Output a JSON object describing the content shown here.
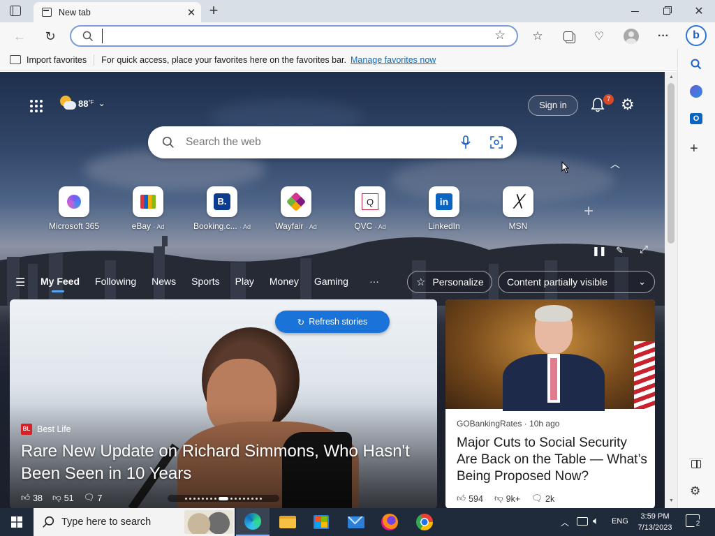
{
  "browser": {
    "tab_title": "New tab",
    "favorites_bar": {
      "import_label": "Import favorites",
      "message": "For quick access, place your favorites here on the favorites bar.",
      "manage_link": "Manage favorites now"
    },
    "address": {
      "value": "",
      "placeholder": ""
    }
  },
  "newtab": {
    "weather": {
      "temp": "88",
      "unit": "°F"
    },
    "sign_in_label": "Sign in",
    "notification_count": "7",
    "search_placeholder": "Search the web",
    "shortcuts": [
      {
        "label": "Microsoft 365",
        "ad": ""
      },
      {
        "label": "eBay",
        "ad": "· Ad"
      },
      {
        "label": "Booking.c...",
        "ad": "· Ad"
      },
      {
        "label": "Wayfair",
        "ad": "· Ad"
      },
      {
        "label": "QVC",
        "ad": "· Ad"
      },
      {
        "label": "LinkedIn",
        "ad": ""
      },
      {
        "label": "MSN",
        "ad": ""
      }
    ],
    "feed_nav": [
      "My Feed",
      "Following",
      "News",
      "Sports",
      "Play",
      "Money",
      "Gaming"
    ],
    "more_label": "···",
    "personalize_label": "Personalize",
    "content_visibility": "Content partially visible",
    "refresh_label": "Refresh stories",
    "main_story": {
      "source": "Best Life",
      "source_badge": "BL",
      "headline": "Rare New Update on Richard Simmons, Who Hasn't Been Seen in 10 Years",
      "likes": "38",
      "dislikes": "51",
      "comments": "7"
    },
    "side_story": {
      "source": "GOBankingRates",
      "age": "10h ago",
      "headline": "Major Cuts to Social Security Are Back on the Table — What’s Being Proposed Now?",
      "likes": "594",
      "dislikes": "9k+",
      "comments": "2k"
    }
  },
  "taskbar": {
    "search_placeholder": "Type here to search",
    "language": "ENG",
    "time": "3:59 PM",
    "date": "7/13/2023",
    "notification_count": "2"
  },
  "colors": {
    "accent": "#0f6cbd",
    "refresh_button": "#1a73d9",
    "taskbar": "#1f2a3a",
    "tabbar": "#d9dfe7"
  }
}
